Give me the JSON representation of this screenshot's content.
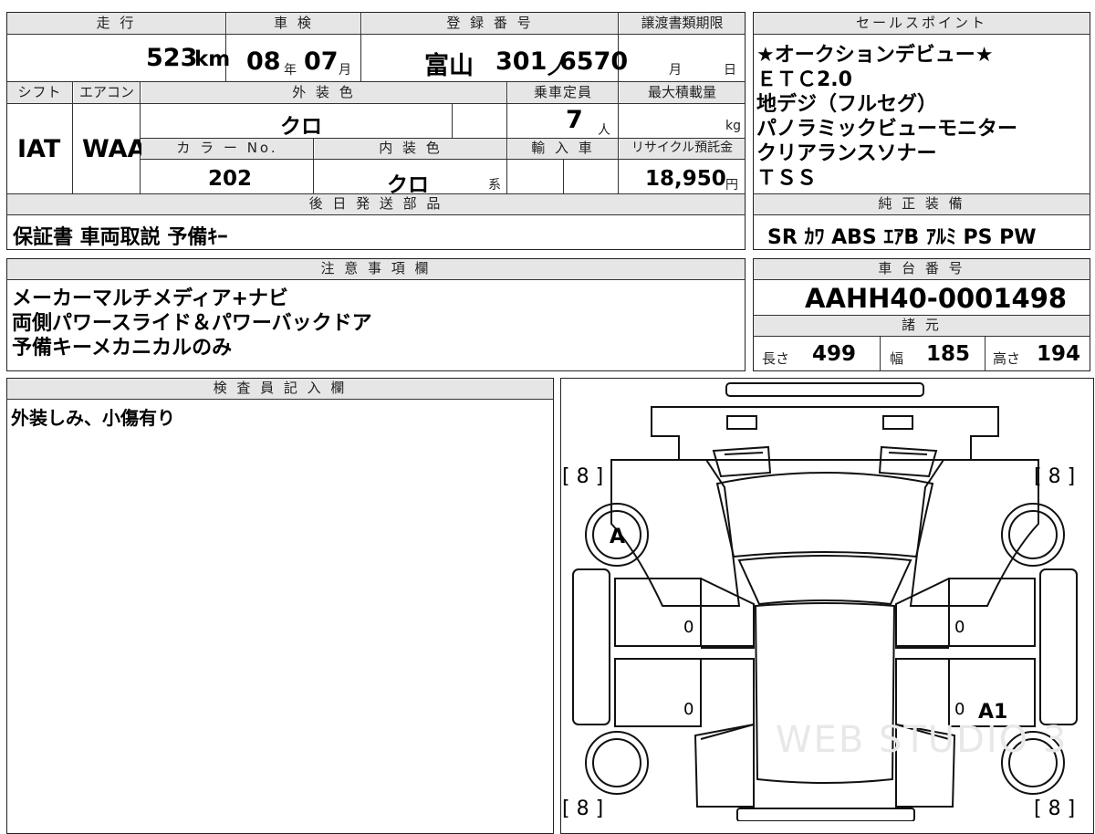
{
  "headers": {
    "mileage": "走 行",
    "inspection": "車 検",
    "registration": "登 録 番 号",
    "transfer_deadline": "譲渡書類期限",
    "sales_points": "セールスポイント",
    "shift": "シフト",
    "aircon": "エアコン",
    "exterior_color": "外 装 色",
    "capacity": "乗車定員",
    "max_load": "最大積載量",
    "color_no": "カ ラ ー No.",
    "interior_color": "内 装 色",
    "import": "輸 入 車",
    "recycle": "リサイクル預託金",
    "later_parts": "後 日 発 送 部 品",
    "genuine_equipment": "純 正 装 備",
    "notes": "注 意 事 項 欄",
    "chassis": "車 台 番 号",
    "specs": "諸 元",
    "inspector": "検 査 員 記 入 欄"
  },
  "vehicle": {
    "mileage_value": "523",
    "mileage_unit": "km",
    "inspection_year": "08",
    "year_unit": "年",
    "inspection_month": "07",
    "month_unit": "月",
    "registration_area": "富山",
    "registration_class": "301",
    "registration_kana": "ノ",
    "registration_number": "6570",
    "deadline_month_unit": "月",
    "deadline_day_unit": "日",
    "shift": "IAT",
    "aircon": "WAA",
    "exterior_color": "クロ",
    "capacity_value": "7",
    "capacity_unit": "人",
    "max_load_unit": "kg",
    "color_no": "202",
    "interior_color": "クロ",
    "interior_suffix": "系",
    "recycle_value": "18,950",
    "recycle_unit": "円",
    "later_parts": "保証書 車両取説 予備ｷｰ",
    "chassis_number": "AAHH40-0001498"
  },
  "sales_points": [
    "★オークションデビュー★",
    "ＥＴＣ2.0",
    "地デジ（フルセグ）",
    "パノラミックビューモニター",
    "クリアランスソナー",
    "ＴＳＳ"
  ],
  "genuine_equipment": "SR ｶﾜ ABS ｴｱB ｱﾙﾐ PS PW",
  "notes": [
    "メーカーマルチメディア+ナビ",
    "両側パワースライド＆パワーバックドア",
    "予備キーメカニカルのみ"
  ],
  "specs": {
    "length_label": "長さ",
    "length_value": "499",
    "width_label": "幅",
    "width_value": "185",
    "height_label": "高さ",
    "height_value": "194"
  },
  "inspector_comment": "外装しみ、小傷有り",
  "diagram": {
    "tire_fl": "[ 8 ]",
    "tire_fr": "[ 8 ]",
    "tire_rl": "[ 8 ]",
    "tire_rr": "[ 8 ]",
    "mark_front_left": "A",
    "mark_rear_right": "A1",
    "door_fl": "0",
    "door_rl": "0",
    "door_fr": "0",
    "door_rr": "0",
    "watermark": "WEB STUDIO 3"
  }
}
